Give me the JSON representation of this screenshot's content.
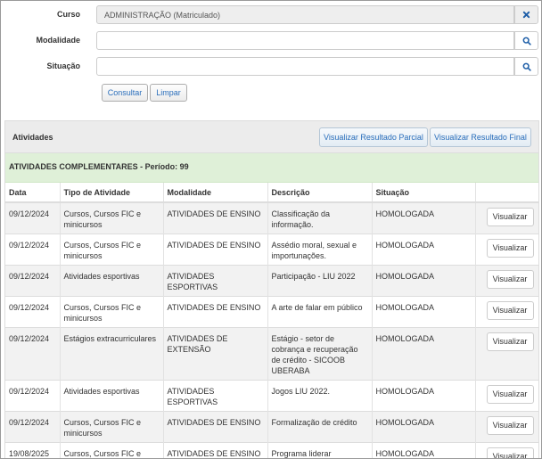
{
  "form": {
    "curso_label": "Curso",
    "curso_value": "ADMINISTRAÇÃO (Matriculado)",
    "modalidade_label": "Modalidade",
    "modalidade_value": "",
    "situacao_label": "Situação",
    "situacao_value": "",
    "consultar_label": "Consultar",
    "limpar_label": "Limpar"
  },
  "panel": {
    "title": "Atividades",
    "btn_parcial": "Visualizar Resultado Parcial",
    "btn_final": "Visualizar Resultado Final",
    "section_title": "ATIVIDADES COMPLEMENTARES - Período: 99"
  },
  "table": {
    "headers": [
      "Data",
      "Tipo de Atividade",
      "Modalidade",
      "Descrição",
      "Situação",
      ""
    ],
    "view_label": "Visualizar",
    "rows": [
      {
        "data": "09/12/2024",
        "tipo": "Cursos, Cursos FIC e minicursos",
        "modalidade": "ATIVIDADES DE ENSINO",
        "descricao": "Classificação da informação.",
        "situacao": "HOMOLOGADA"
      },
      {
        "data": "09/12/2024",
        "tipo": "Cursos, Cursos FIC e minicursos",
        "modalidade": "ATIVIDADES DE ENSINO",
        "descricao": "Assédio moral, sexual e importunações.",
        "situacao": "HOMOLOGADA"
      },
      {
        "data": "09/12/2024",
        "tipo": "Atividades esportivas",
        "modalidade": "ATIVIDADES ESPORTIVAS",
        "descricao": "Participação - LIU 2022",
        "situacao": "HOMOLOGADA"
      },
      {
        "data": "09/12/2024",
        "tipo": "Cursos, Cursos FIC e minicursos",
        "modalidade": "ATIVIDADES DE ENSINO",
        "descricao": "A arte de falar em público",
        "situacao": "HOMOLOGADA"
      },
      {
        "data": "09/12/2024",
        "tipo": "Estágios extracurriculares",
        "modalidade": "ATIVIDADES DE EXTENSÃO",
        "descricao": "Estágio - setor de cobrança e recuperação de crédito - SICOOB UBERABA",
        "situacao": "HOMOLOGADA"
      },
      {
        "data": "09/12/2024",
        "tipo": "Atividades esportivas",
        "modalidade": "ATIVIDADES ESPORTIVAS",
        "descricao": "Jogos LIU 2022.",
        "situacao": "HOMOLOGADA"
      },
      {
        "data": "09/12/2024",
        "tipo": "Cursos, Cursos FIC e minicursos",
        "modalidade": "ATIVIDADES DE ENSINO",
        "descricao": "Formalização de crédito",
        "situacao": "HOMOLOGADA"
      },
      {
        "data": "19/08/2025",
        "tipo": "Cursos, Cursos FIC e minicursos",
        "modalidade": "ATIVIDADES DE ENSINO",
        "descricao": "Programa liderar",
        "situacao": "HOMOLOGADA"
      }
    ]
  },
  "icons": {
    "clear": "close-icon",
    "search": "search-icon"
  },
  "colors": {
    "link": "#2a6ebb",
    "section_bg": "#dff0d8",
    "panel_heading_bg": "#ececec",
    "striped_row": "#f2f2f2"
  }
}
